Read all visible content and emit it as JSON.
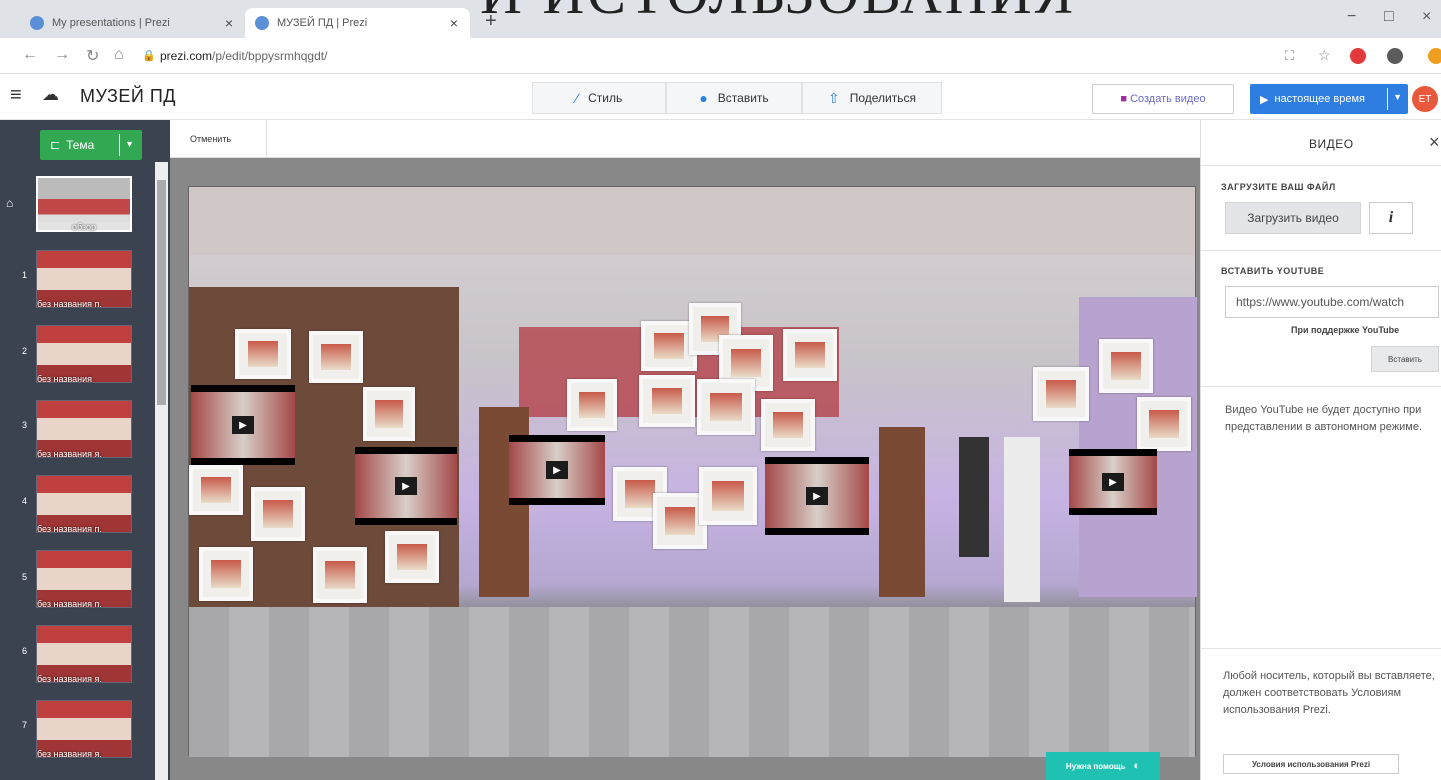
{
  "overlay_title": "И ИСТОЛЬЗОВАНИЯ",
  "browser": {
    "tabs": [
      {
        "label": "My presentations | Prezi",
        "close": "×"
      },
      {
        "label": "МУЗЕЙ ПД | Prezi",
        "close": "×"
      }
    ],
    "new_tab": "+",
    "url_host": "prezi.com",
    "url_path": "/p/edit/bppysrmhqgdt/",
    "win_minimize": "−",
    "win_maximize": "□",
    "win_close": "×"
  },
  "app": {
    "title": "МУЗЕЙ ПД",
    "toolbar": {
      "style": "Стиль",
      "insert": "Вставить",
      "share": "Поделиться"
    },
    "create_video": "Создать видео",
    "present": "настоящее время",
    "avatar_initials": "ЕТ"
  },
  "sidebar": {
    "theme": "Тема",
    "slides": [
      {
        "num": "",
        "label": "обзор"
      },
      {
        "num": "1",
        "label": "без названия п."
      },
      {
        "num": "2",
        "label": "без названия"
      },
      {
        "num": "3",
        "label": "без названия я."
      },
      {
        "num": "4",
        "label": "без названия п."
      },
      {
        "num": "5",
        "label": "без названия п."
      },
      {
        "num": "6",
        "label": "без названия я."
      },
      {
        "num": "7",
        "label": "без названия я."
      }
    ]
  },
  "editor": {
    "cancel": "Отменить",
    "help": "Нужна помощь"
  },
  "video_panel": {
    "title": "ВИДЕО",
    "upload_header": "ЗАГРУЗИТЕ ВАШ ФАЙЛ",
    "upload_button": "Загрузить видео",
    "info_button": "i",
    "youtube_header": "ВСТАВИТЬ YOUTUBE",
    "youtube_value": "https://www.youtube.com/watch",
    "youtube_support": "При поддержке YouTube",
    "insert_button": "Вставить",
    "youtube_note": "Видео YouTube не будет доступно при представлении в автономном режиме.",
    "terms_text": "Любой носитель, который вы вставляете, должен соответствовать Условиям использования Prezi.",
    "terms_button": "Условия использования Prezi"
  },
  "colors": {
    "accent": "#2e7de0",
    "theme_green": "#32a852",
    "help_teal": "#1fc2b2",
    "sidebar_bg": "#3b4250"
  }
}
